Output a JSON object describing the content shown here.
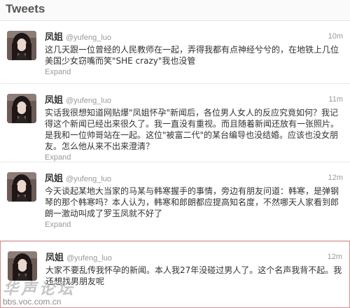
{
  "header": {
    "title": "Tweets"
  },
  "icons": {
    "avatar": "user-photo-icon"
  },
  "tweets": [
    {
      "name": "凤姐",
      "handle": "@yufeng_luo",
      "time": "10m",
      "text": "这几天跟一位曾经的人民教师在一起，弄得我都有点神经兮兮的，在地铁上几位美国少女窃嘴而笑\"SHE crazy\"我也没管",
      "expand": "Expand"
    },
    {
      "name": "凤姐",
      "handle": "@yufeng_luo",
      "time": "11m",
      "text": "实话我很想知道网贴爆\"凤姐怀孕\"新闻后，各位男人女人的反应究竟如何？我记得这个新闻已经出来很久了。我一直没有重视。而且随着新闻还放有一张照片。是我和一位帅哥站在一起。这位\"被富二代\"的某台编导也没结婚。应该也没女朋友。怎么他从来不出来澄清？",
      "expand": "Expand"
    },
    {
      "name": "凤姐",
      "handle": "@yufeng_luo",
      "time": "12m",
      "text": "今天谈起某地大当家的马某与韩寒握手的事情，旁边有朋友问道：韩寒，是弹钢琴的那个韩寒吗？本人认为，韩寒和郎朗都应提高知名度，不然哪天人家看到郎朗一激动叫成了罗玉凤就不好了",
      "expand": "Expand"
    },
    {
      "name": "凤姐",
      "handle": "@yufeng_luo",
      "time": "12m",
      "text": "大家不要乱传我怀孕的新闻。本人我27年没碰过男人了。这个名声我背不起。我还想找男朋友呢",
      "expand": ""
    }
  ],
  "watermark": {
    "script": "华声论坛",
    "url": "bbs.voc.com.cn"
  },
  "colors": {
    "highlight_border": "#e08a8a",
    "meta_gray": "#999999",
    "text": "#333333"
  }
}
